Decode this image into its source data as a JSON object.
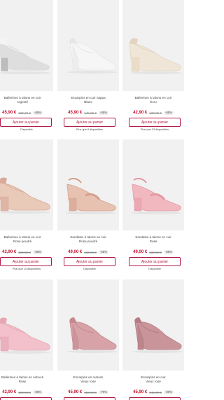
{
  "products": [
    {
      "title": "Ballerines à talons en cuir\nArgenté",
      "price": "45,90 €",
      "old_price": "130,90 €",
      "discount": "-66%",
      "button": "Ajouter au panier",
      "availability": "Disponible",
      "colors": {
        "main": "#dedede",
        "accent": "#f4f4f4",
        "heel": "#bdbdbd"
      }
    },
    {
      "title": "Escarpins en cuir nappa\nBlanc",
      "price": "45,90 €",
      "old_price": "145,90 €",
      "discount": "-69%",
      "button": "Ajouter au panier",
      "availability": "Plus que 8 disponibles",
      "colors": {
        "main": "#f6f6f6",
        "accent": "#e6e6e6",
        "heel": "#ededed"
      }
    },
    {
      "title": "Ballerines à talons en cuir\nÉcru",
      "price": "42,90 €",
      "old_price": "130,90 €",
      "discount": "-68%",
      "button": "Ajouter au panier",
      "availability": "Plus que 13 disponibles",
      "colors": {
        "main": "#f0e6d8",
        "accent": "#e2d4c0",
        "heel": "#eadcc6"
      }
    },
    {
      "title": "Ballerines à talons en cuir\nRose poudré",
      "price": "42,90 €",
      "old_price": "130,90 €",
      "discount": "-68%",
      "button": "Ajouter au panier",
      "availability": "Plus que 13 disponibles",
      "colors": {
        "main": "#e9c9b8",
        "accent": "#d9aa99",
        "heel": "#deb6a4"
      }
    },
    {
      "title": "Sandales à talons en cuir\nRose poudré",
      "price": "49,00 €",
      "old_price": "132,90 €",
      "discount": "-65%",
      "button": "Ajouter au panier",
      "availability": "Disponible",
      "colors": {
        "main": "#e8c2b1",
        "accent": "#d4a08d",
        "heel": "#dcae9b"
      }
    },
    {
      "title": "Sandales à talons en cuir\nRose",
      "price": "49,00 €",
      "old_price": "132,90 €",
      "discount": "-65%",
      "button": "Ajouter au panier",
      "availability": "Disponible",
      "colors": {
        "main": "#f1b8c0",
        "accent": "#e39aa5",
        "heel": "#eaa8b2"
      }
    },
    {
      "title": "Ballerines à talons en nubuck\nRose",
      "price": "42,90 €",
      "old_price": "130,90 €",
      "discount": "-68%",
      "button": "Ajouter au panier",
      "availability": "",
      "colors": {
        "main": "#f2c1cb",
        "accent": "#e6a6b3",
        "heel": "#eab0bc"
      }
    },
    {
      "title": "Escarpins en nubuck\nVieux rose",
      "price": "45,90 €",
      "old_price": "153,90 €",
      "discount": "-70%",
      "button": "Ajouter au panier",
      "availability": "",
      "colors": {
        "main": "#d7a3a8",
        "accent": "#c58a90",
        "heel": "#cd959b"
      }
    },
    {
      "title": "Escarpins en cuir\nVieux rosé",
      "price": "45,90 €",
      "old_price": "145,90 €",
      "discount": "-69%",
      "button": "Ajouter au panier",
      "availability": "",
      "colors": {
        "main": "#c9959b",
        "accent": "#b47c83",
        "heel": "#bd868d"
      }
    }
  ]
}
